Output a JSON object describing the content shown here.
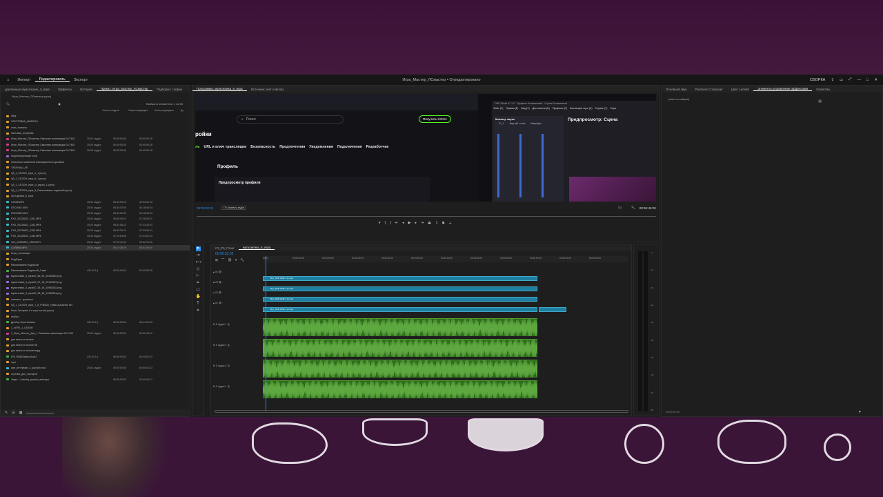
{
  "app": {
    "title": "Игра_Мастер_ЛСмастер • Отредактировано",
    "nav": [
      "Импорт",
      "Редактировать",
      "Экспорт"
    ],
    "nav_active": "Редактировать",
    "right_label": "СБОРКА"
  },
  "project_panel": {
    "tabs": [
      "удаленные мультисниз_3_игра",
      "Эффекты",
      "История",
      "Проект: Игра_Мастер_ЛСмастер",
      "Подборки: собран"
    ],
    "active_tab": "Проект: Игра_Мастер_ЛСмастер",
    "subtitle": "Игра_Мастер_ЛСмастер.prproj",
    "selected_count": "Выбрано элементов: 1 из 53",
    "columns": [
      "Частота кадров",
      "Запуск медиаданн",
      "Конец медиаданн",
      "Дл"
    ],
    "rows": [
      {
        "name": "Звук",
        "fr": "",
        "s": "",
        "e": "",
        "c": "#e0a030"
      },
      {
        "name": "ЗАГОТОВКА_ШАБЛОН",
        "fr": "",
        "s": "",
        "e": "",
        "c": "#e0a030"
      },
      {
        "name": "спис_тыкьата",
        "fr": "",
        "s": "",
        "e": "",
        "c": "#e0a030"
      },
      {
        "name": "Заставка_вторбова",
        "fr": "",
        "s": "",
        "e": "",
        "c": "#e0a030"
      },
      {
        "name": "Игра_Мастер_ЛСмастер Сквозная композиция 01/7445",
        "fr": "25,00 кадр/с",
        "s": "00:00:00:00",
        "e": "00:00:00:18",
        "c": "#d23c8c"
      },
      {
        "name": "Игра_Мастер_ЛСмастер Сквозная композиция 01/7445",
        "fr": "25,00 кадр/с",
        "s": "00:00:00:00",
        "e": "00:00:00:18",
        "c": "#d23c8c"
      },
      {
        "name": "Игра_Мастер_ЛСмастер Сквозная композиция 01/7445",
        "fr": "25,00 кадр/с",
        "s": "00:00:00:00",
        "e": "00:00:00:18",
        "c": "#d23c8c"
      },
      {
        "name": "Корректирующий слой",
        "fr": "",
        "s": "",
        "e": "",
        "c": "#9a6ad8"
      },
      {
        "name": "Несколько шаблонов анимационного дизайна",
        "fr": "",
        "s": "",
        "e": "",
        "c": "#e0a030"
      },
      {
        "name": "ТАБЛИЦЫ_AE",
        "fr": "",
        "s": "",
        "e": "",
        "c": "#e0a030"
      },
      {
        "name": "УД_1_СЕЗОН_игра_1_1.prproj",
        "fr": "",
        "s": "",
        "e": "",
        "c": "#e0a030"
      },
      {
        "name": "УД_1_СЕЗОН_игра_6_1.prproj",
        "fr": "",
        "s": "",
        "e": "",
        "c": "#e0a030"
      },
      {
        "name": "УД_1_СЕЗОН_игра_И_карты_1.prproj",
        "fr": "",
        "s": "",
        "e": "",
        "c": "#e0a030"
      },
      {
        "name": "УД_1_СЕЗОН_игра_5_Распиливаем подписей.prproj",
        "fr": "",
        "s": "",
        "e": "",
        "c": "#e0a030"
      },
      {
        "name": "ИСХодники_6_игра",
        "fr": "",
        "s": "",
        "e": "",
        "c": "#e0a030"
      },
      {
        "name": "С2938.MP4",
        "fr": "25,00 кадр/с",
        "s": "00:53:09:19",
        "e": "00:53:51:12",
        "c": "#3fb8c8"
      },
      {
        "name": "DSC0081.MOV",
        "fr": "25,00 кадр/с",
        "s": "05:34:02:00",
        "e": "04:18:43:24",
        "c": "#3fb8c8"
      },
      {
        "name": "DSC0080.MOV",
        "fr": "25,00 кадр/с",
        "s": "05:44:02:00",
        "e": "04:18:43:24",
        "c": "#3fb8c8"
      },
      {
        "name": "FXD_20230822_1351.MP4",
        "fr": "25,00 кадр/с",
        "s": "06:50:09:12",
        "e": "07:28:35:01",
        "c": "#3fb8c8"
      },
      {
        "name": "FXD_20230822_1352.MP4",
        "fr": "25,00 кадр/с",
        "s": "06:51:58:12",
        "e": "07:23:33:01",
        "c": "#3fb8c8"
      },
      {
        "name": "FXD_20230822_1353.MP4",
        "fr": "25,00 кадр/с",
        "s": "06:53:39:12",
        "e": "07:30:59:01",
        "c": "#3fb8c8"
      },
      {
        "name": "FXD_20230822_1354.MP4",
        "fr": "25,00 кадр/с",
        "s": "07:12:53:06",
        "e": "07:34:02:23",
        "c": "#3fb8c8"
      },
      {
        "name": "4X3_20230822_1355.MP4",
        "fr": "25,00 кадр/с",
        "s": "07:34:41:24",
        "e": "04:52:41:00",
        "c": "#3fb8c8"
      },
      {
        "name": "L1V5860.MP4",
        "fr": "25,00 кадр/с",
        "s": "05:14:28:19",
        "e": "05:52:08:00",
        "c": "#3fb8c8",
        "sel": true
      },
      {
        "name": "Игры_Сплоищен",
        "fr": "",
        "s": "",
        "e": "",
        "c": "#e0a030"
      },
      {
        "name": "Подборки",
        "fr": "",
        "s": "",
        "e": "",
        "c": "#e0a030"
      },
      {
        "name": "Распиливаем Подписей",
        "fr": "",
        "s": "",
        "e": "",
        "c": "#e0a030"
      },
      {
        "name": "Распиливаем Подписей_3 мин",
        "fr": "400.00 Гц",
        "s": "00:00:00:00",
        "e": "00:03:53:26",
        "c": "#3fb04a"
      },
      {
        "name": "мультипяка_5_игра00_56_52_20198302.png",
        "fr": "",
        "s": "",
        "e": "",
        "c": "#9a6ad8"
      },
      {
        "name": "мультипяка_5_игра00_57_18_20198302.png",
        "fr": "",
        "s": "",
        "e": "",
        "c": "#9a6ad8"
      },
      {
        "name": "мультипяка_5_игра00_36_18_15988302.png",
        "fr": "",
        "s": "",
        "e": "",
        "c": "#9a6ad8"
      },
      {
        "name": "мультипяка_5_игра00_38_36_11398304.png",
        "fr": "",
        "s": "",
        "e": "",
        "c": "#9a6ad8"
      },
      {
        "name": "плагины - длинные",
        "fr": "",
        "s": "",
        "e": "",
        "c": "#e0a030"
      },
      {
        "name": "УД_1_СЕЗОН_игра_7_8_РЭББИ_Тревь в длином бег",
        "fr": "",
        "s": "",
        "e": "",
        "c": "#e0a030"
      },
      {
        "name": "Колы Экспресс 8 в игра соглас.prproj",
        "fr": "",
        "s": "",
        "e": "",
        "c": "#e0a030"
      },
      {
        "name": "глобал",
        "fr": "",
        "s": "",
        "e": "",
        "c": "#e0a030"
      },
      {
        "name": "Дробер Игра Анскиш",
        "fr": "400.00 Гц",
        "s": "00:00:00:00",
        "e": "00:41:20:09",
        "c": "#3fb04a"
      },
      {
        "name": "1_ИГРА_1_СЕЗОН",
        "fr": "",
        "s": "",
        "e": "",
        "c": "#e0a030"
      },
      {
        "name": "1_Игра_Мастер_Дяо_1 Сквозная композиция 01/7449",
        "fr": "25,00 кадр/с",
        "s": "00:00:00:00",
        "e": "00:00:43:21",
        "c": "#d23c8c"
      },
      {
        "name": "для иметь в начале",
        "fr": "",
        "s": "",
        "e": "",
        "c": "#e0a030"
      },
      {
        "name": "для иметь в начале 88",
        "fr": "",
        "s": "",
        "e": "",
        "c": "#e0a030"
      },
      {
        "name": "для иметь в начале/лерд",
        "fr": "",
        "s": "",
        "e": "",
        "c": "#e0a030"
      },
      {
        "name": "ES1780633aВасЛьор3",
        "fr": "441.00 Гц",
        "s": "00:00:00:00",
        "e": "00:00:01:23",
        "c": "#3fb04a"
      },
      {
        "name": "зорт",
        "fr": "",
        "s": "",
        "e": "",
        "c": "#e0a030"
      },
      {
        "name": "сме_интервью_з_школой.mp4",
        "fr": "25,00 кадр/с",
        "s": "00:00:00:00",
        "e": "00:00:01:23",
        "c": "#3fb8c8"
      },
      {
        "name": "стрелка_для_экспорта",
        "fr": "",
        "s": "",
        "e": "",
        "c": "#e0a030"
      },
      {
        "name": "Звука - Luchshij_sposob_вейтера",
        "fr": "",
        "s": "00:00:00:00",
        "e": "00:00:04:17",
        "c": "#3fb04a"
      }
    ]
  },
  "source_monitor": {
    "tabs": [
      "Программа: мультипяка_6_игра",
      "Источник: (нет клипов)"
    ],
    "timecode": "00:00:32:03",
    "end_timecode": "00:50:45:02",
    "fit": "По размеру кадра",
    "quality": "1/2",
    "screen": {
      "search_placeholder": "Поиск",
      "kick_button": "Получить KICKs",
      "heading": "ройки",
      "menu": [
        "ль",
        "URL и ключ трансляции",
        "Безопасность",
        "Предпочтения",
        "Уведомления",
        "Подключения",
        "Разработчик"
      ],
      "profile_label": "Профиль",
      "preview_label": "Предпросмотр профиля",
      "obs_title": "OBS Studio 31.1.2 - Профиль Безымянный - Сцены Безымянный",
      "obs_menu": [
        "Файл (F)",
        "Правка (E)",
        "Вид (V)",
        "Док-панели (D)",
        "Профиль (P)",
        "Коллекция сцен (S)",
        "Сервис (T)",
        "Спра"
      ],
      "obs_mixer": "Микшер звука",
      "obs_mixer_cols": [
        "Р1_1",
        "Звук раб. стола",
        "Микрофон"
      ],
      "obs_preview": "Предпросмотр: Сцена"
    }
  },
  "right_panel": {
    "tabs": [
      "Основной звук",
      "Premiere Composer",
      "Цвет Lumetri",
      "Элементы управления эффектами",
      "Свойства"
    ],
    "active_tab": "Элементы управления эффектами",
    "empty_msg": "(клип не выбран)",
    "footer_time": "00:00:32:03"
  },
  "timeline": {
    "tabs": [
      "С3_Р6_Глоьт",
      "мультипяка_6_игра"
    ],
    "active_tab": "мультипяка_6_игра",
    "timecode": "00:00:32:03",
    "ruler": [
      "00:00",
      "00:05:00:00",
      "00:10:00:00",
      "00:15:00:00",
      "00:20:00:00",
      "00:25:00:00",
      "00:30:00:00",
      "00:35:00:00",
      "00:40:00:00",
      "00:45:00:00",
      "00:50:00:00",
      "00:55:00:00"
    ],
    "video_tracks": [
      "V4",
      "V3",
      "V2",
      "V1"
    ],
    "audio_tracks": [
      "Аудио 1",
      "Аудио 2",
      "Аудио 3",
      "Аудио 4"
    ],
    "clip_label": "Ягр_SUD CAM 1 (4.mp4",
    "meter_ticks": [
      "-6",
      "-12",
      "-18",
      "-24",
      "-30",
      "-36",
      "-42",
      "-48",
      "-54",
      "dB"
    ]
  },
  "colors": {
    "accent": "#2d8ceb",
    "video_clip": "#1f7fa0",
    "audio_clip": "#2f6e1c",
    "wave": "#7fcf5a"
  }
}
